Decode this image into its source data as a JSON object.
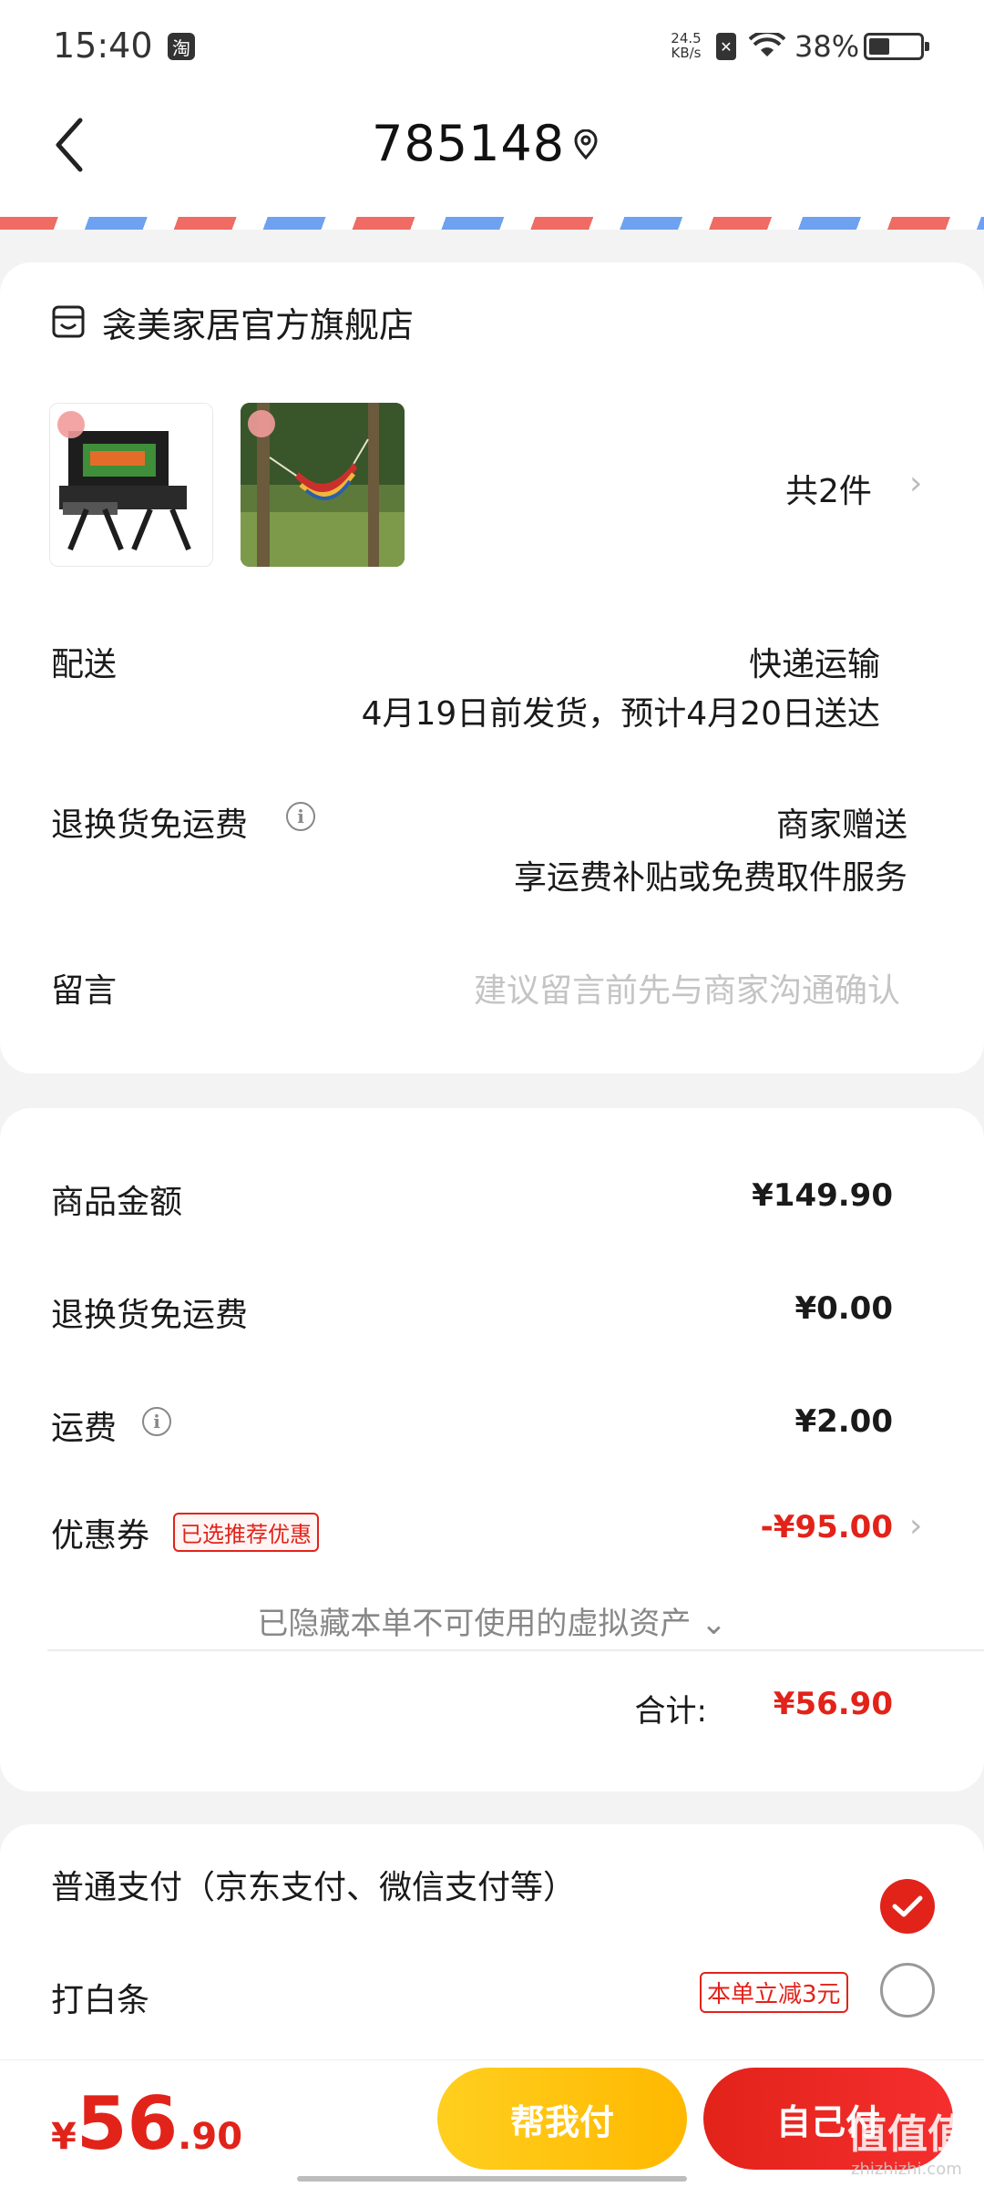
{
  "status_bar": {
    "time": "15:40",
    "app_badge": "淘",
    "net_speed_value": "24.5",
    "net_speed_unit": "KB/s",
    "battery": "38%",
    "battery_level": 0.38
  },
  "header": {
    "title": "785148",
    "icons": [
      "back-arrow-icon",
      "location-pin-icon"
    ]
  },
  "order": {
    "store_name": "衾美家居官方旗舰店",
    "item_count": "共2件",
    "delivery_label": "配送",
    "delivery_method": "快递运输",
    "delivery_time": "4月19日前发货，预计4月20日送达",
    "return_label": "退换货免运费",
    "return_value": "商家赠送",
    "return_desc": "享运费补贴或免费取件服务",
    "message_label": "留言",
    "message_placeholder": "建议留言前先与商家沟通确认"
  },
  "pricing": {
    "goods_label": "商品金额",
    "goods_value": "¥149.90",
    "return_label": "退换货免运费",
    "return_value": "¥0.00",
    "shipping_label": "运费",
    "shipping_value": "¥2.00",
    "coupon_label": "优惠券",
    "coupon_badge": "已选推荐优惠",
    "coupon_value": "-¥95.00",
    "hidden_note": "已隐藏本单不可使用的虚拟资产 ⌄",
    "total_label": "合计:",
    "total_value": "¥56.90"
  },
  "payment": {
    "option1_label": "普通支付（京东支付、微信支付等）",
    "option1_selected": true,
    "option2_label": "打白条",
    "option2_badge": "本单立减3元",
    "option2_selected": false
  },
  "bottom": {
    "currency": "¥",
    "amount_int": "56",
    "amount_dec": ".90",
    "help_pay_label": "帮我付",
    "self_pay_label": "自己付",
    "watermark": "值值值",
    "watermark_sub": "zhizhizhi.com"
  },
  "colors": {
    "accent_red": "#e2231a",
    "accent_yellow": "#ffc20e"
  }
}
